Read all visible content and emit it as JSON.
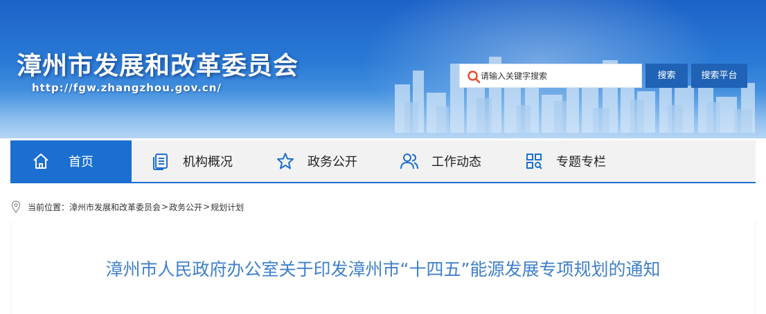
{
  "header": {
    "site_title": "漳州市发展和改革委员会",
    "site_url": "http://fgw.zhangzhou.gov.cn/",
    "search": {
      "placeholder": "请输入关键字搜索",
      "value": ""
    },
    "search_button_label": "搜索",
    "platform_button_label": "搜索平台",
    "colors": {
      "banner": "#2a7ad6",
      "button": "#1f62b6"
    }
  },
  "nav": {
    "accent": "#1b6fd0",
    "items": [
      {
        "label": "首页",
        "icon": "home-icon",
        "active": true
      },
      {
        "label": "机构概况",
        "icon": "document-list-icon",
        "active": false
      },
      {
        "label": "政务公开",
        "icon": "star-icon",
        "active": false
      },
      {
        "label": "工作动态",
        "icon": "people-icon",
        "active": false
      },
      {
        "label": "专题专栏",
        "icon": "grid-icon",
        "active": false
      }
    ]
  },
  "breadcrumb": {
    "prefix": "当前位置：",
    "items": [
      "漳州市发展和改革委员会",
      "政务公开",
      "规划计划"
    ],
    "separator": ">"
  },
  "article": {
    "title": "漳州市人民政府办公室关于印发漳州市“十四五”能源发展专项规划的通知",
    "title_color": "#3f7fc9"
  }
}
